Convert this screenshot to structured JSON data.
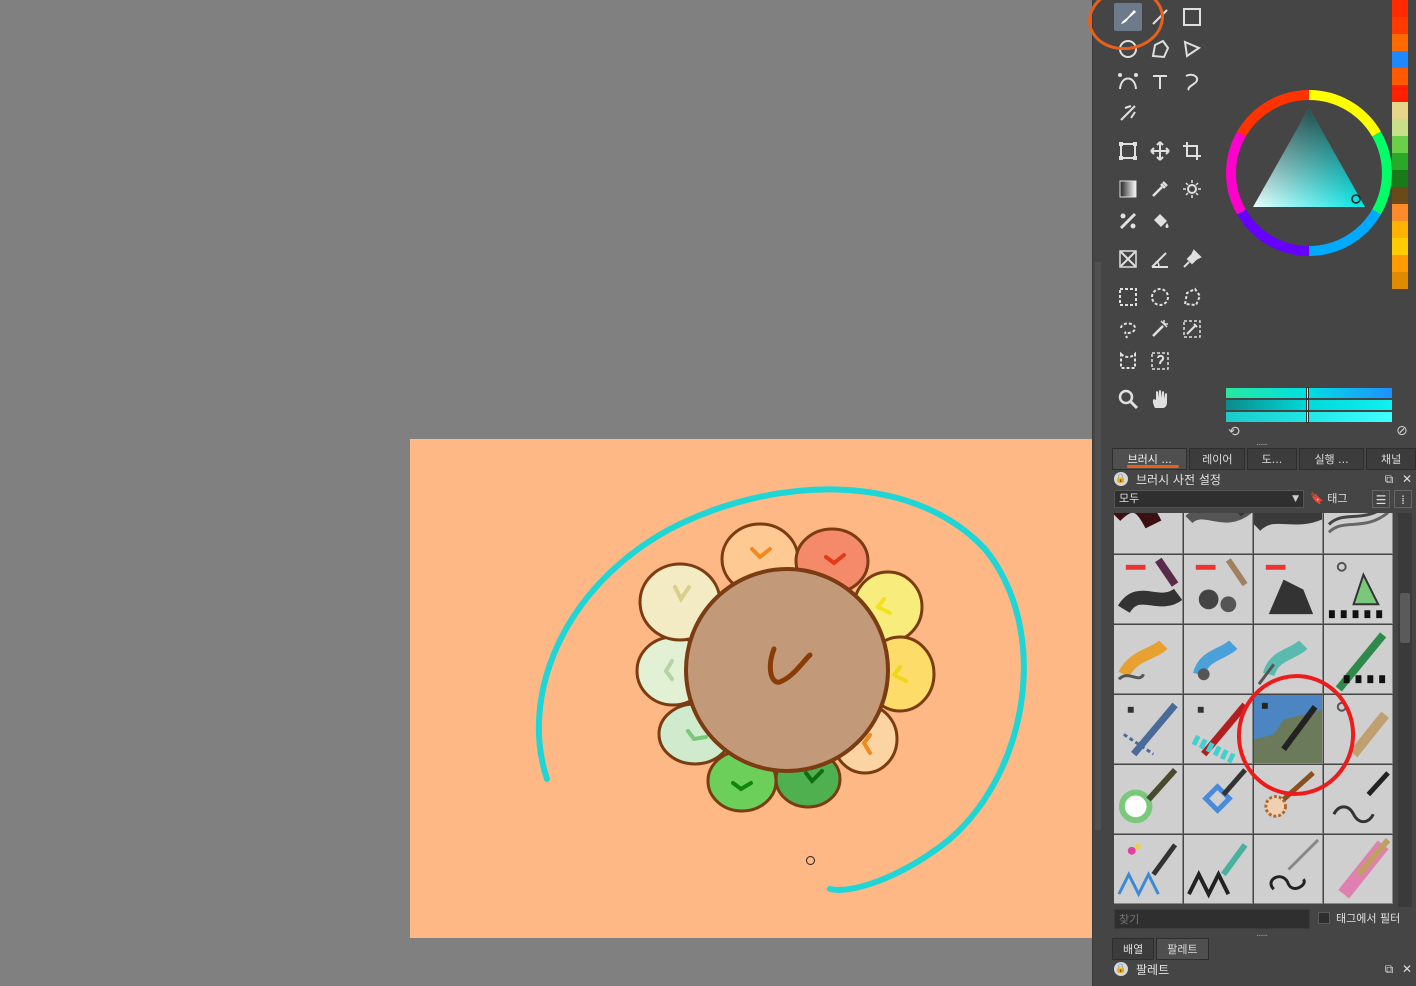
{
  "canvas": {
    "background": "#808080",
    "artboard_color": "#FEB885"
  },
  "toolbox": {
    "active_tool": "freehand-brush",
    "tools": [
      "freehand-brush",
      "line",
      "rectangle",
      "ellipse",
      "polygon",
      "polyline",
      "bezier-curve",
      "dynamic-brush",
      "freehand-path",
      "multibrush",
      "transform",
      "move",
      "crop",
      "gradient",
      "color-picker",
      "smart-patch",
      "colorize-mask",
      "fill",
      "assistant",
      "measure",
      "reference-images",
      "rect-select",
      "ellipse-select",
      "polygon-select",
      "freehand-select",
      "contiguous-select",
      "similar-select",
      "bezier-select",
      "magnetic-select",
      "zoom",
      "pan"
    ]
  },
  "color_selector": {
    "current_color": "#00e5e5",
    "palette_swatches": [
      "#ff2a00",
      "#ff3b00",
      "#ff6a00",
      "#1e88ff",
      "#ff5a00",
      "#ff2000",
      "#e8d58a",
      "#c8e08a",
      "#6ccf4a",
      "#2aa82a",
      "#1a7a1a",
      "#6b4a1a",
      "#ff8a2a",
      "#ffb300",
      "#ffcc00",
      "#ff9a00",
      "#e08a00"
    ]
  },
  "tabs": [
    {
      "label": "브러시 ...",
      "active": true
    },
    {
      "label": "레이어",
      "active": false
    },
    {
      "label": "도...",
      "active": false
    },
    {
      "label": "실행 ...",
      "active": false
    },
    {
      "label": "채널",
      "active": false
    }
  ],
  "brush_presets_panel": {
    "title": "브러시 사전 설정",
    "tag_filter": "모두",
    "tag_button": "태그",
    "search_placeholder": "찾기",
    "filter_in_tag_label": "태그에서 필터"
  },
  "bottom_tabs": [
    {
      "label": "배열",
      "active": false
    },
    {
      "label": "팔레트",
      "active": true
    }
  ],
  "palette_panel": {
    "title": "팔레트"
  }
}
